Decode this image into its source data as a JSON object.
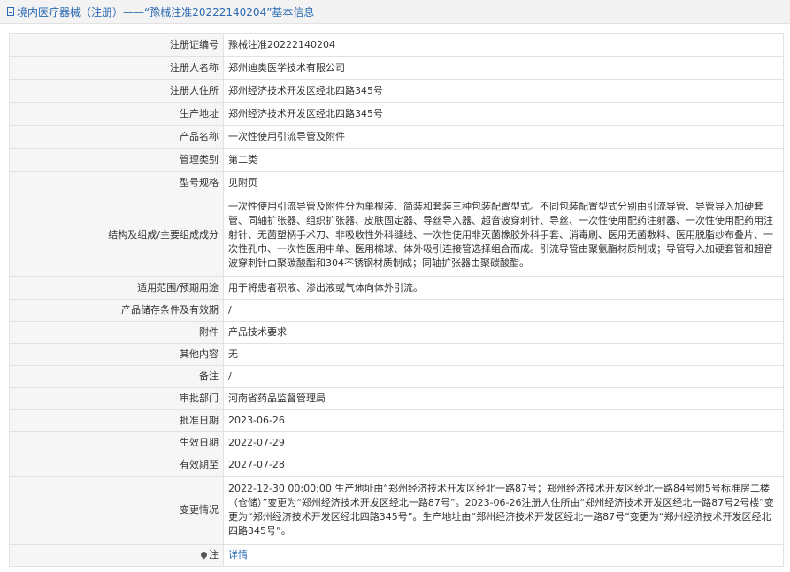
{
  "header": {
    "title": "境内医疗器械（注册）——“豫械注准20222140204”基本信息",
    "icon": "document-icon"
  },
  "rows": [
    {
      "label": "注册证编号",
      "value": "豫械注准20222140204"
    },
    {
      "label": "注册人名称",
      "value": "郑州迪奥医学技术有限公司"
    },
    {
      "label": "注册人住所",
      "value": "郑州经济技术开发区经北四路345号"
    },
    {
      "label": "生产地址",
      "value": "郑州经济技术开发区经北四路345号"
    },
    {
      "label": "产品名称",
      "value": "一次性使用引流导管及附件"
    },
    {
      "label": "管理类别",
      "value": "第二类"
    },
    {
      "label": "型号规格",
      "value": "见附页"
    },
    {
      "label": "结构及组成/主要组成成分",
      "value": "一次性使用引流导管及附件分为单根装、简装和套装三种包装配置型式。不同包装配置型式分别由引流导管、导管导入加硬套管、同轴扩张器、组织扩张器、皮肤固定器、导丝导入器、超音波穿刺针、导丝、一次性使用配药注射器、一次性使用配药用注射针、无菌塑柄手术刀、非吸收性外科缝线、一次性使用非灭菌橡胶外科手套、消毒刷、医用无菌敷料、医用脱脂纱布叠片、一次性孔巾、一次性医用中单、医用棉球、体外吸引连接管选择组合而成。引流导管由聚氨酯材质制成；导管导入加硬套管和超音波穿刺针由聚碳酸酯和304不锈钢材质制成；同轴扩张器由聚碳酸酯。"
    },
    {
      "label": "适用范围/预期用途",
      "value": "用于将患者积液、渗出液或气体向体外引流。"
    },
    {
      "label": "产品储存条件及有效期",
      "value": "/"
    },
    {
      "label": "附件",
      "value": "产品技术要求"
    },
    {
      "label": "其他内容",
      "value": "无"
    },
    {
      "label": "备注",
      "value": "/"
    },
    {
      "label": "审批部门",
      "value": "河南省药品监督管理局"
    },
    {
      "label": "批准日期",
      "value": "2023-06-26"
    },
    {
      "label": "生效日期",
      "value": "2022-07-29"
    },
    {
      "label": "有效期至",
      "value": "2027-07-28"
    },
    {
      "label": "变更情况",
      "value": "2022-12-30 00:00:00 生产地址由“郑州经济技术开发区经北一路87号；郑州经济技术开发区经北一路84号附5号标准房二楼（仓储）”变更为“郑州经济技术开发区经北一路87号”。2023-06-26注册人住所由“郑州经济技术开发区经北一路87号2号楼”变更为“郑州经济技术开发区经北四路345号”。生产地址由“郑州经济技术开发区经北一路87号”变更为“郑州经济技术开发区经北四路345号”。"
    }
  ],
  "note": {
    "label": "注",
    "link": "详情",
    "icon": "pin-icon"
  }
}
